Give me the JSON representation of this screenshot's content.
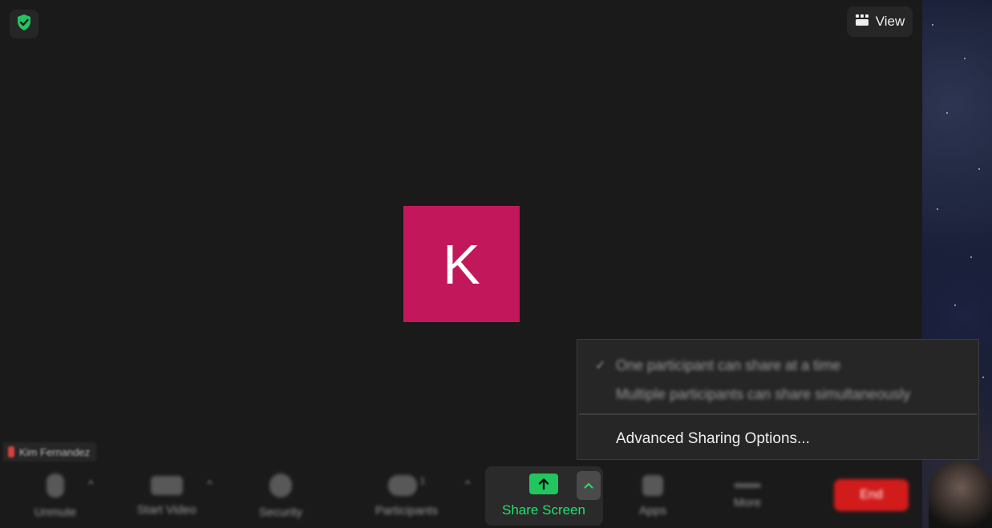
{
  "header": {
    "view_label": "View"
  },
  "avatar": {
    "initial": "K",
    "color": "#c2185b"
  },
  "participant": {
    "name": "Kim Fernandez"
  },
  "toolbar": {
    "unmute_label": "Unmute",
    "start_video_label": "Start Video",
    "security_label": "Security",
    "participants_label": "Participants",
    "participants_count": "1",
    "share_screen_label": "Share Screen",
    "apps_label": "Apps",
    "more_label": "More",
    "end_label": "End",
    "share_accent": "#22e06a"
  },
  "share_menu": {
    "option_one": "One participant can share at a time",
    "option_multiple": "Multiple participants can share simultaneously",
    "advanced": "Advanced Sharing Options..."
  }
}
